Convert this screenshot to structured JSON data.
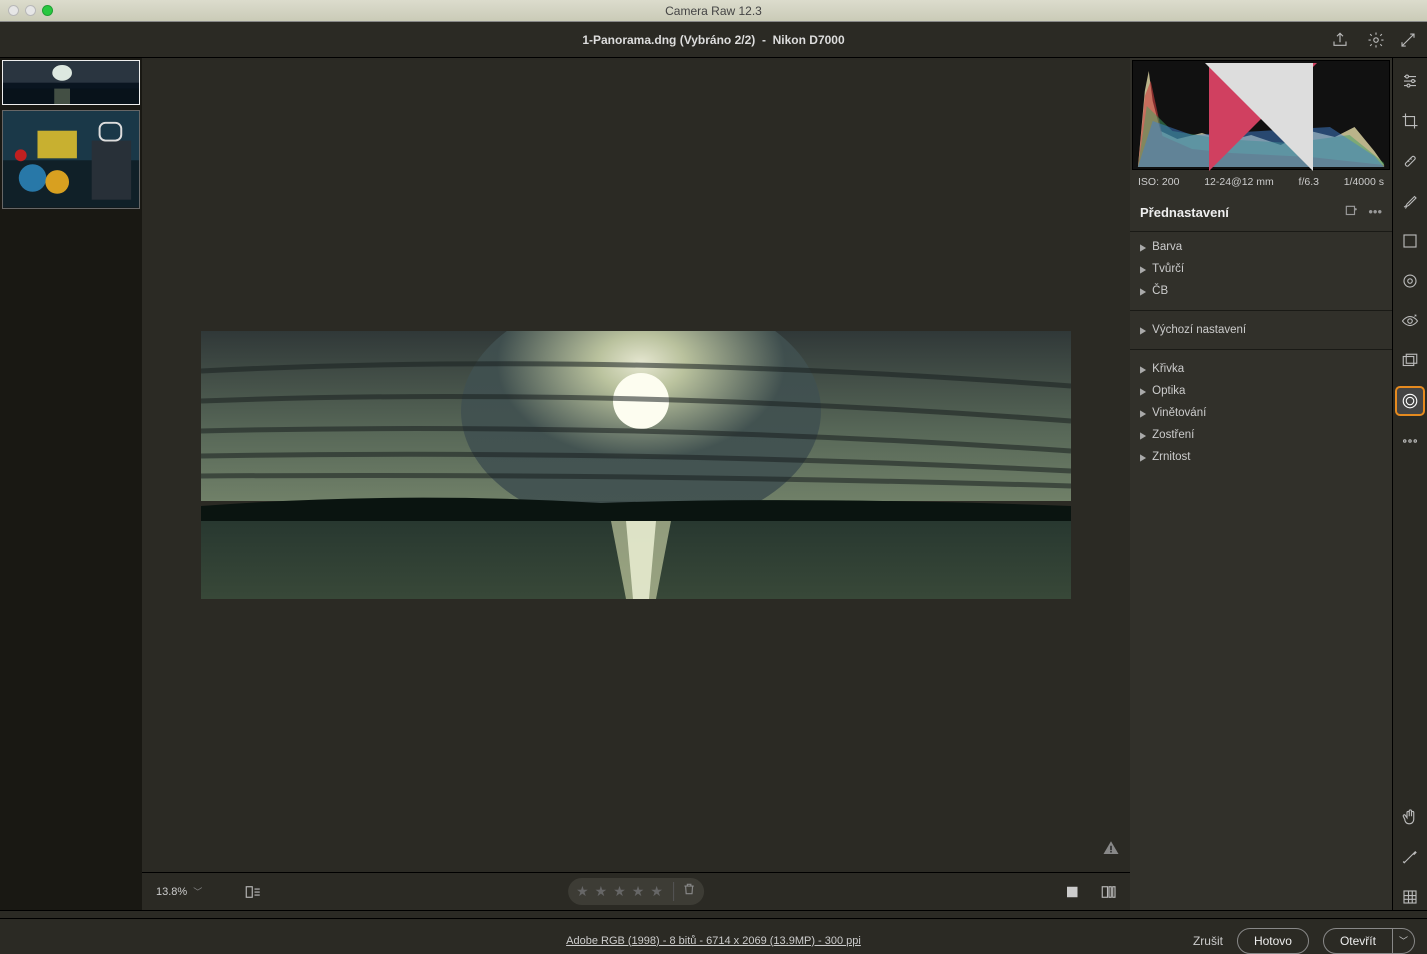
{
  "window": {
    "title": "Camera Raw 12.3"
  },
  "doc": {
    "filename": "1-Panorama.dng",
    "selection": "(Vybráno 2/2)",
    "sep": "-",
    "camera": "Nikon D7000"
  },
  "meta": {
    "iso": "ISO: 200",
    "lens": "12-24@12 mm",
    "aperture": "f/6.3",
    "shutter": "1/4000 s"
  },
  "panel": {
    "title": "Přednastavení"
  },
  "presets_a": [
    "Barva",
    "Tvůrčí",
    "ČB"
  ],
  "presets_b": [
    "Výchozí nastavení"
  ],
  "presets_c": [
    "Křivka",
    "Optika",
    "Vinětování",
    "Zostření",
    "Zrnitost"
  ],
  "previewbar": {
    "zoom": "13.8%"
  },
  "footer": {
    "workflow": "Adobe RGB (1998) - 8 bitů - 6714 x 2069 (13.9MP) - 300 ppi",
    "cancel": "Zrušit",
    "done": "Hotovo",
    "open": "Otevřít"
  }
}
